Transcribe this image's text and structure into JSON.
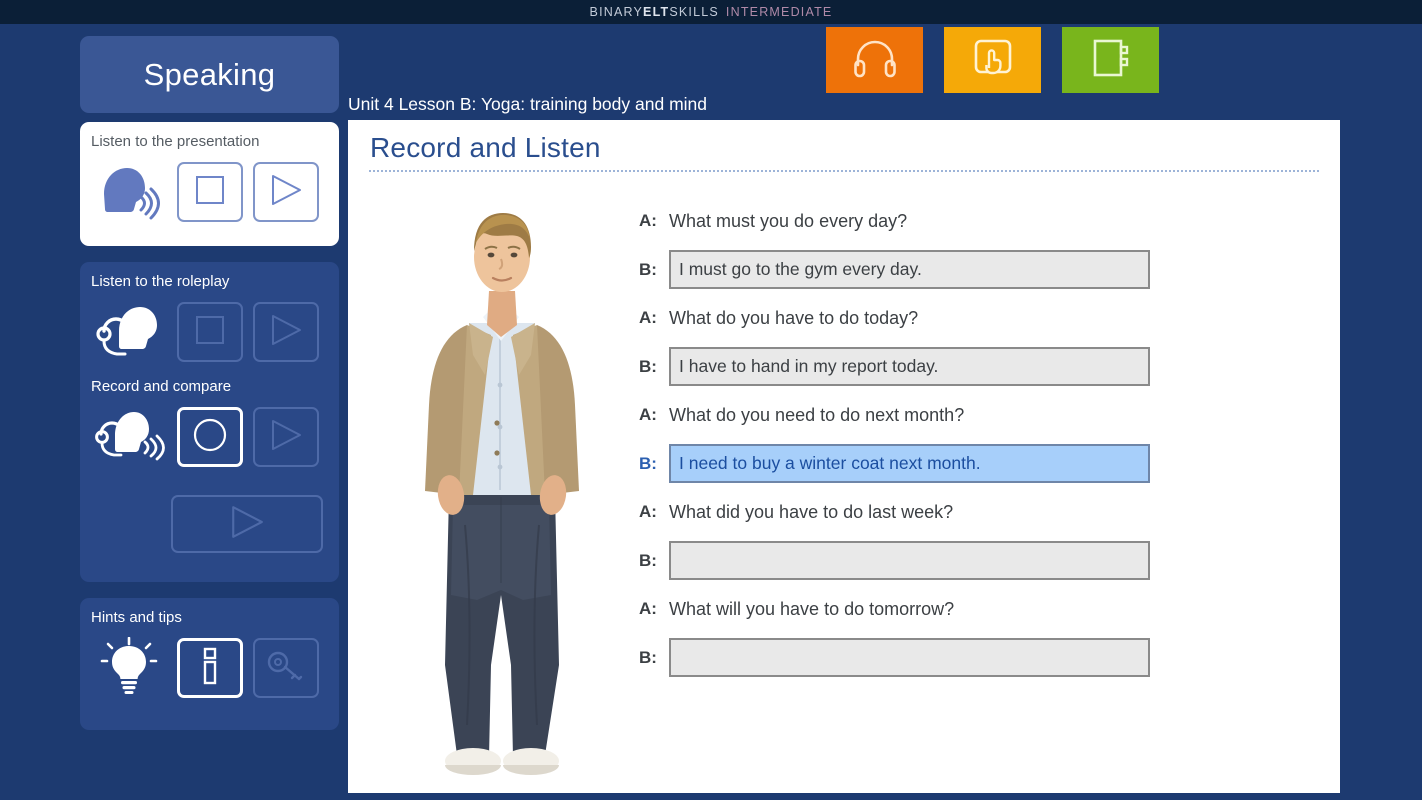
{
  "brand": {
    "prefix": "BINARY ",
    "bold": "ELT",
    "mid": "SKILLS",
    "level": "INTERMEDIATE"
  },
  "header": {
    "section_label": "Speaking",
    "lesson_title": "Unit 4 Lesson B: Yoga: training body and mind"
  },
  "toolbar": {
    "buttons": [
      {
        "name": "audio-button",
        "icon": "headphones-icon",
        "color": "#ee7209"
      },
      {
        "name": "interactive-button",
        "icon": "hand-tap-icon",
        "color": "#f5a908"
      },
      {
        "name": "notebook-button",
        "icon": "notebook-icon",
        "color": "#79b51c"
      }
    ]
  },
  "sidebar": {
    "panels": [
      {
        "title": "Listen to the presentation",
        "style": "white",
        "icon": "speaking-head-icon",
        "controls": [
          {
            "name": "stop-button",
            "icon": "stop-icon",
            "state": "enabled"
          },
          {
            "name": "play-button",
            "icon": "play-icon",
            "state": "enabled"
          }
        ]
      },
      {
        "title": "Listen to the roleplay",
        "style": "blue",
        "icon": "headset-head-icon",
        "controls": [
          {
            "name": "stop-button",
            "icon": "stop-icon",
            "state": "dim"
          },
          {
            "name": "play-button",
            "icon": "play-icon",
            "state": "dim"
          }
        ],
        "subsection": {
          "title": "Record and compare",
          "icon": "headset-mic-speaking-icon",
          "controls": [
            {
              "name": "record-button",
              "icon": "record-icon",
              "state": "active"
            },
            {
              "name": "play-recording-button",
              "icon": "play-icon",
              "state": "dim"
            },
            {
              "name": "play-comparison-button",
              "icon": "play-icon",
              "state": "dim-wide"
            }
          ]
        }
      },
      {
        "title": "Hints and tips",
        "style": "blue",
        "icon": "lightbulb-icon",
        "controls": [
          {
            "name": "info-button",
            "icon": "info-icon",
            "state": "active"
          },
          {
            "name": "answer-key-button",
            "icon": "key-icon",
            "state": "dim"
          }
        ]
      }
    ]
  },
  "main": {
    "title": "Record and Listen",
    "image": {
      "name": "man-standing-photo",
      "alt": "Young man in tan blazer and jeans"
    },
    "dialogue": [
      {
        "speaker": "A:",
        "type": "question",
        "text": "What must you do every day?"
      },
      {
        "speaker": "B:",
        "type": "answer",
        "text": "I must go to the gym every day.",
        "highlighted": false
      },
      {
        "speaker": "A:",
        "type": "question",
        "text": "What do you have to do today?"
      },
      {
        "speaker": "B:",
        "type": "answer",
        "text": "I have to hand in my report today.",
        "highlighted": false
      },
      {
        "speaker": "A:",
        "type": "question",
        "text": "What do you need to do next month?"
      },
      {
        "speaker": "B:",
        "type": "answer",
        "text": "I need to buy a winter coat next month.",
        "highlighted": true
      },
      {
        "speaker": "A:",
        "type": "question",
        "text": "What did you have to do last week?"
      },
      {
        "speaker": "B:",
        "type": "answer",
        "text": "",
        "highlighted": false
      },
      {
        "speaker": "A:",
        "type": "question",
        "text": "What will you have to do tomorrow?"
      },
      {
        "speaker": "B:",
        "type": "answer",
        "text": "",
        "highlighted": false
      }
    ]
  },
  "colors": {
    "page_background": "#1d3a70",
    "brandbar": "#0b1f37",
    "panel_blue": "#2a4887",
    "speaking_pill": "#3a5795",
    "title_blue": "#2a4e8e",
    "highlight_fill": "#a7cffa",
    "highlight_text": "#1b4ea0",
    "answer_fill": "#e9e9e9",
    "answer_border": "#8a8a8a"
  }
}
